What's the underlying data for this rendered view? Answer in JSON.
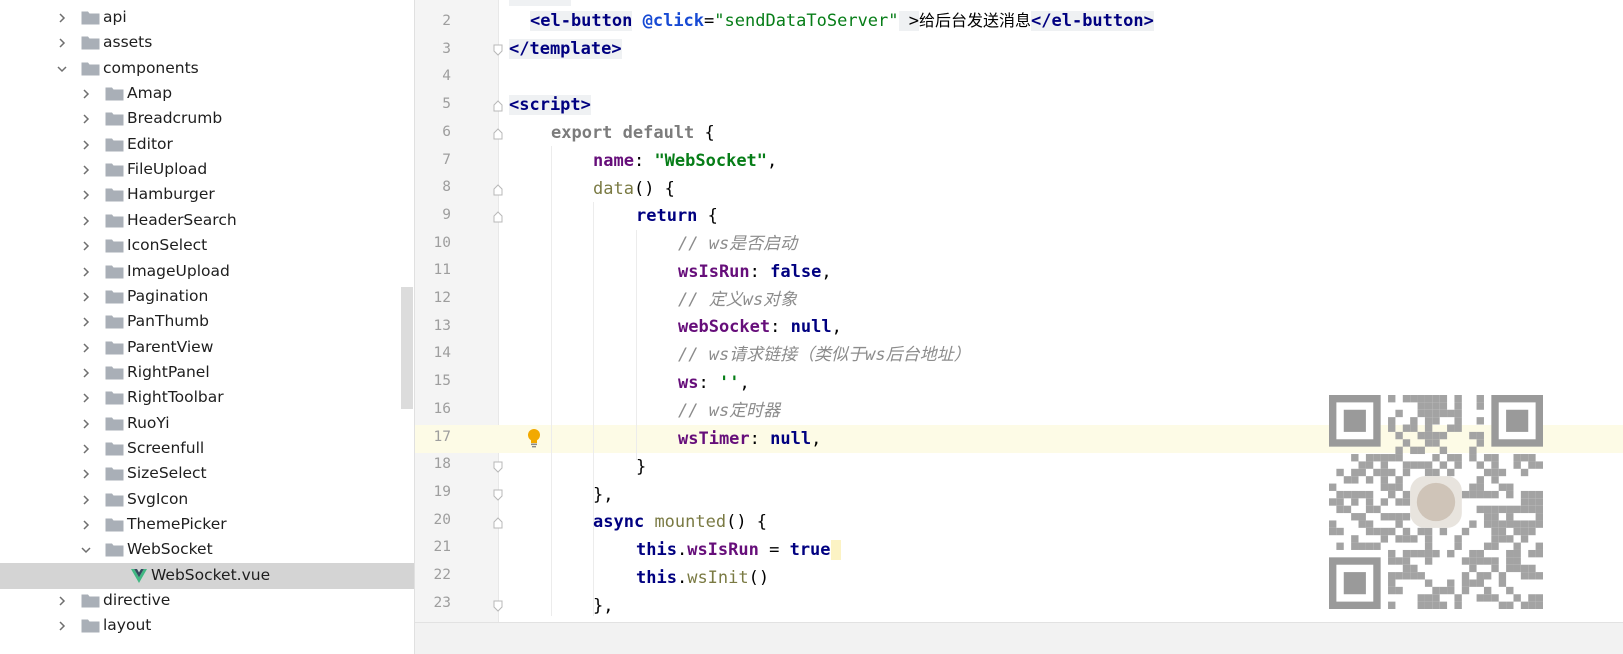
{
  "project_tree": {
    "items": [
      {
        "label": "api",
        "depth": 1,
        "expanded": false,
        "type": "folder"
      },
      {
        "label": "assets",
        "depth": 1,
        "expanded": false,
        "type": "folder"
      },
      {
        "label": "components",
        "depth": 1,
        "expanded": true,
        "type": "folder"
      },
      {
        "label": "Amap",
        "depth": 2,
        "expanded": false,
        "type": "folder"
      },
      {
        "label": "Breadcrumb",
        "depth": 2,
        "expanded": false,
        "type": "folder"
      },
      {
        "label": "Editor",
        "depth": 2,
        "expanded": false,
        "type": "folder"
      },
      {
        "label": "FileUpload",
        "depth": 2,
        "expanded": false,
        "type": "folder"
      },
      {
        "label": "Hamburger",
        "depth": 2,
        "expanded": false,
        "type": "folder"
      },
      {
        "label": "HeaderSearch",
        "depth": 2,
        "expanded": false,
        "type": "folder"
      },
      {
        "label": "IconSelect",
        "depth": 2,
        "expanded": false,
        "type": "folder"
      },
      {
        "label": "ImageUpload",
        "depth": 2,
        "expanded": false,
        "type": "folder"
      },
      {
        "label": "Pagination",
        "depth": 2,
        "expanded": false,
        "type": "folder"
      },
      {
        "label": "PanThumb",
        "depth": 2,
        "expanded": false,
        "type": "folder"
      },
      {
        "label": "ParentView",
        "depth": 2,
        "expanded": false,
        "type": "folder"
      },
      {
        "label": "RightPanel",
        "depth": 2,
        "expanded": false,
        "type": "folder"
      },
      {
        "label": "RightToolbar",
        "depth": 2,
        "expanded": false,
        "type": "folder"
      },
      {
        "label": "RuoYi",
        "depth": 2,
        "expanded": false,
        "type": "folder"
      },
      {
        "label": "Screenfull",
        "depth": 2,
        "expanded": false,
        "type": "folder"
      },
      {
        "label": "SizeSelect",
        "depth": 2,
        "expanded": false,
        "type": "folder"
      },
      {
        "label": "SvgIcon",
        "depth": 2,
        "expanded": false,
        "type": "folder"
      },
      {
        "label": "ThemePicker",
        "depth": 2,
        "expanded": false,
        "type": "folder"
      },
      {
        "label": "WebSocket",
        "depth": 2,
        "expanded": true,
        "type": "folder"
      },
      {
        "label": "WebSocket.vue",
        "depth": 3,
        "expanded": false,
        "type": "vue-file",
        "selected": true
      },
      {
        "label": "directive",
        "depth": 1,
        "expanded": false,
        "type": "folder"
      },
      {
        "label": "layout",
        "depth": 1,
        "expanded": false,
        "type": "folder"
      }
    ]
  },
  "editor": {
    "line_numbers": [
      "2",
      "3",
      "4",
      "5",
      "6",
      "7",
      "8",
      "9",
      "10",
      "11",
      "12",
      "13",
      "14",
      "15",
      "16",
      "17",
      "18",
      "19",
      "20",
      "21",
      "22",
      "23"
    ],
    "current_line": "17",
    "tokens": {
      "l2_tag_open": "<el-button",
      "l2_attr": "@click",
      "l2_eq": "=",
      "l2_attr_val": "\"sendDataToServer\"",
      "l2_close": " >",
      "l2_text": "给后台发送消息",
      "l2_end_tag": "</el-button>",
      "l3": "</template>",
      "l5": "<script>",
      "l6_kw": "export default",
      "l6_rest": " {",
      "l7_prop": "name",
      "l7_colon": ": ",
      "l7_str": "\"WebSocket\"",
      "l7_comma": ",",
      "l8_fn": "data",
      "l8_rest": "() {",
      "l9_kw": "return",
      "l9_rest": " {",
      "l10_cm": "// ws是否启动",
      "l11_prop": "wsIsRun",
      "l11_colon": ": ",
      "l11_val": "false",
      "l11_comma": ",",
      "l12_cm": "// 定义ws对象",
      "l13_prop": "webSocket",
      "l13_colon": ": ",
      "l13_val": "null",
      "l13_comma": ",",
      "l14_cm": "// ws请求链接（类似于ws后台地址）",
      "l15_prop": "ws",
      "l15_colon": ": ",
      "l15_str": "''",
      "l15_comma": ",",
      "l16_cm": "// ws定时器",
      "l17_prop": "wsTimer",
      "l17_colon": ": ",
      "l17_val": "null",
      "l17_comma": ",",
      "l18": "}",
      "l19": "},",
      "l20_kw": "async",
      "l20_fn": "mounted",
      "l20_rest": "() {",
      "l21_this": "this",
      "l21_dot": ".",
      "l21_prop": "wsIsRun",
      "l21_eq": " = ",
      "l21_val": "true",
      "l22_this": "this",
      "l22_dot": ".",
      "l22_fn": "wsInit",
      "l22_rest": "()",
      "l23": "},"
    }
  },
  "colors": {
    "keyword": "#000080",
    "property": "#660e7a",
    "string": "#067d17",
    "comment": "#8c8c8c",
    "current_line_bg": "#fdfbe6",
    "selected_tree_bg": "#d4d4d4"
  },
  "icons": {
    "folder": "folder-icon",
    "vue": "vue-file-icon",
    "expand": "chevron-right-icon",
    "collapse": "chevron-down-icon",
    "intention": "lightbulb-icon",
    "qr": "qr-code-watermark"
  }
}
